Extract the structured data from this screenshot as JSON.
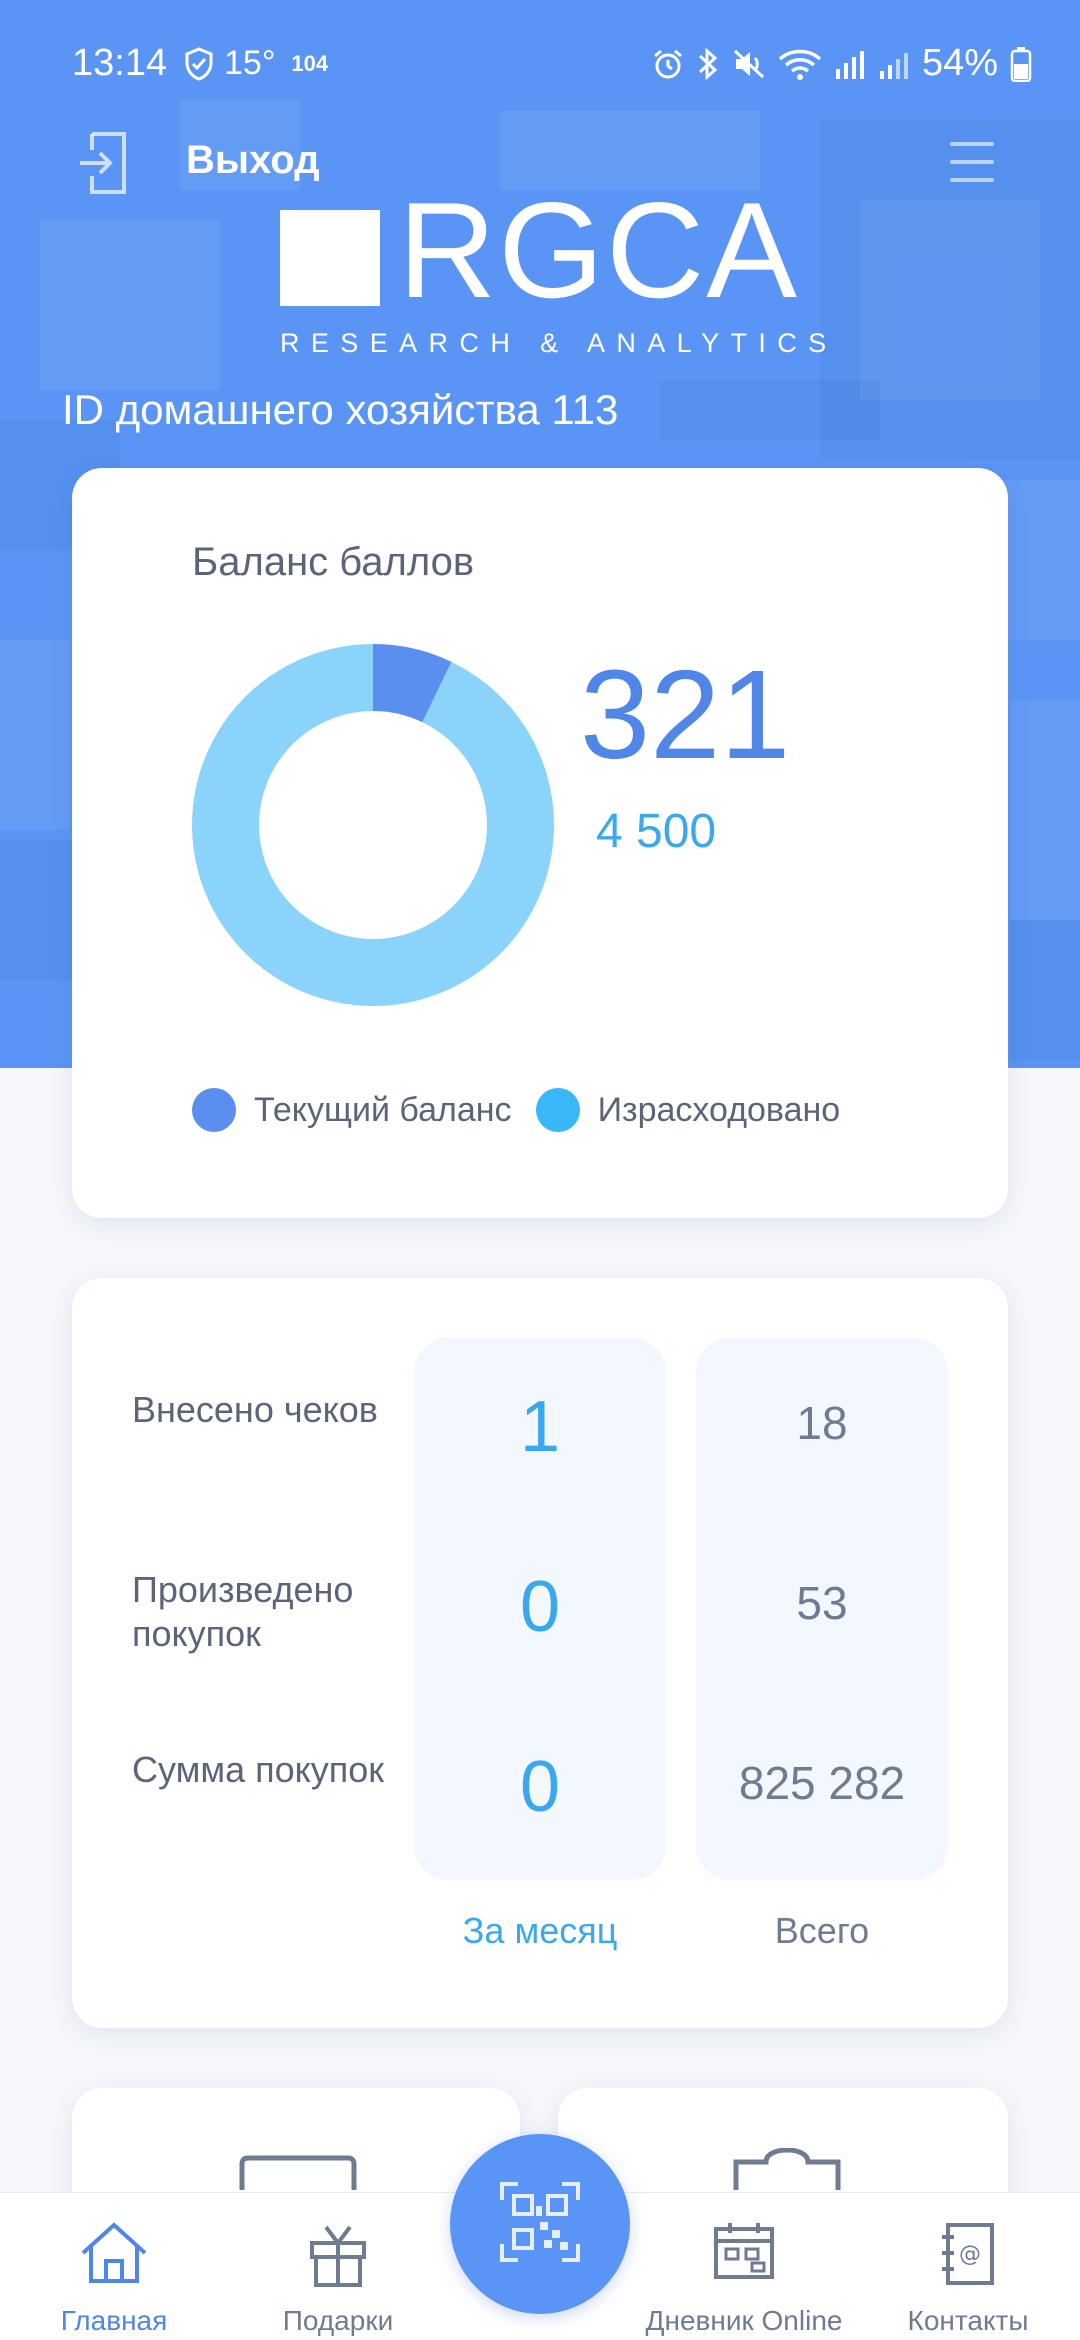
{
  "status_bar": {
    "time": "13:14",
    "temperature": "15°",
    "extra": "104",
    "battery": "54%"
  },
  "header": {
    "logout_label": "Выход",
    "logo_word": "RGCA",
    "logo_tagline": "RESEARCH & ANALYTICS",
    "household_id": "ID домашнего хозяйства 113"
  },
  "balance_card": {
    "title": "Баланс баллов",
    "current": "321",
    "total": "4 500",
    "legend": [
      {
        "label": "Текущий баланс",
        "color": "#5a8ff0"
      },
      {
        "label": "Израсходовано",
        "color": "#3ab7f7"
      }
    ]
  },
  "chart_data": {
    "type": "pie",
    "donut": true,
    "categories": [
      "Текущий баланс",
      "Израсходовано"
    ],
    "values": [
      321,
      4179
    ],
    "total": 4500,
    "colors": [
      "#5a8ff0",
      "#8ad3fb"
    ],
    "legend_position": "bottom"
  },
  "stats_card": {
    "rows": [
      {
        "label": "Внесено чеков",
        "month": "1",
        "total": "18"
      },
      {
        "label": "Произведено покупок",
        "month": "0",
        "total": "53"
      },
      {
        "label": "Сумма покупок",
        "month": "0",
        "total": "825 282"
      }
    ],
    "month_caption": "За месяц",
    "total_caption": "Всего"
  },
  "bottom_nav": {
    "items": [
      {
        "label": "Главная",
        "icon": "home-icon",
        "active": true
      },
      {
        "label": "Подарки",
        "icon": "gift-icon",
        "active": false
      },
      {
        "label": "Дневник Online",
        "icon": "calendar-icon",
        "active": false
      },
      {
        "label": "Контакты",
        "icon": "contacts-book-icon",
        "active": false
      }
    ],
    "center_button_icon": "qr-scan-icon"
  },
  "colors": {
    "brand": "#5a95f5",
    "accent": "#3aa8ee",
    "text": "#5b6478"
  }
}
